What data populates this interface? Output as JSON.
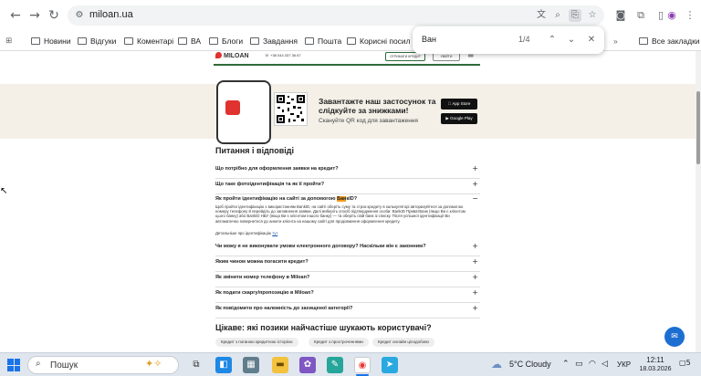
{
  "browser": {
    "url": "miloan.ua",
    "bookmarks": [
      "Новини",
      "Відгуки",
      "Коментарі",
      "ВА",
      "Блоги",
      "Завдання",
      "Пошта",
      "Корисні посилання"
    ],
    "all_bookmarks": "Все закладки",
    "find": {
      "query": "Ван",
      "count": "1/4"
    }
  },
  "site_header": {
    "logo": "MILOAN",
    "phone": "+38 044 337 36 67",
    "get_credit": "ОТРИМАТИ КРЕДИТ",
    "login": "УВІЙТИ"
  },
  "app_banner": {
    "title": "Завантажте наш застосунок та слідкуйте за знижками!",
    "subtitle": "Скануйте QR код для завантаження",
    "app_store": "App Store",
    "google_play": "Google Play"
  },
  "faq": {
    "title": "Питання і відповіді",
    "questions": [
      {
        "text": "Що потрібно для оформлення заявки на кредит?",
        "toggle": "+"
      },
      {
        "text": "Що таке фотоідентифікація та як її пройти?",
        "toggle": "+"
      },
      {
        "text_before": "Як пройти ідентифікацію на сайті за допомогою ",
        "highlight": "Бан",
        "text_after": "кID?",
        "toggle": "−"
      },
      {
        "text": "Чи можу я не виконувати умови електронного договору? Наскільки він є законним?",
        "toggle": "+"
      },
      {
        "text": "Яким чином можна погасити кредит?",
        "toggle": "+"
      },
      {
        "text": "Як змінити номер телефону в Miloan?",
        "toggle": "+"
      },
      {
        "text": "Як подати скаргу/пропозицію в Miloan?",
        "toggle": "+"
      },
      {
        "text": "Як повідомити про належність до захищеної категорії?",
        "toggle": "+"
      }
    ],
    "answer": "Щоб пройти ідентифікацію з використанням BankID, на сайті оберіть суму та строк кредиту в калькуляторі авторизуйтеся за допомогою номеру телефону й перейдіть до заповнення заявки. Далі виберіть спосіб підтвердження особи: BankID ПриватБанк (якщо Ви є клієнтом цього банку) або BankID НБУ (якщо Ви є клієнтом іншого банку) — та оберіть свій банк зі списку. Після успішної ідентифікації Ви автоматично повернетеся до анкети клієнта на нашому сайті для продовження оформлення кредиту.",
    "details_label": "Детальніше про ідентифікацію",
    "details_link": "тут"
  },
  "popular": {
    "title": "Цікаве: які позики найчастіше шукають користувачі?",
    "chips": [
      "Кредит з поганою кредитною історією",
      "Кредит з простроченнями",
      "Кредит онлайн цілодобово"
    ]
  },
  "taskbar": {
    "search": "Пошук",
    "weather": "5°C  Cloudy",
    "lang": "УКР",
    "time": "12:11",
    "date": "18.03.2026",
    "notifications": "5"
  }
}
